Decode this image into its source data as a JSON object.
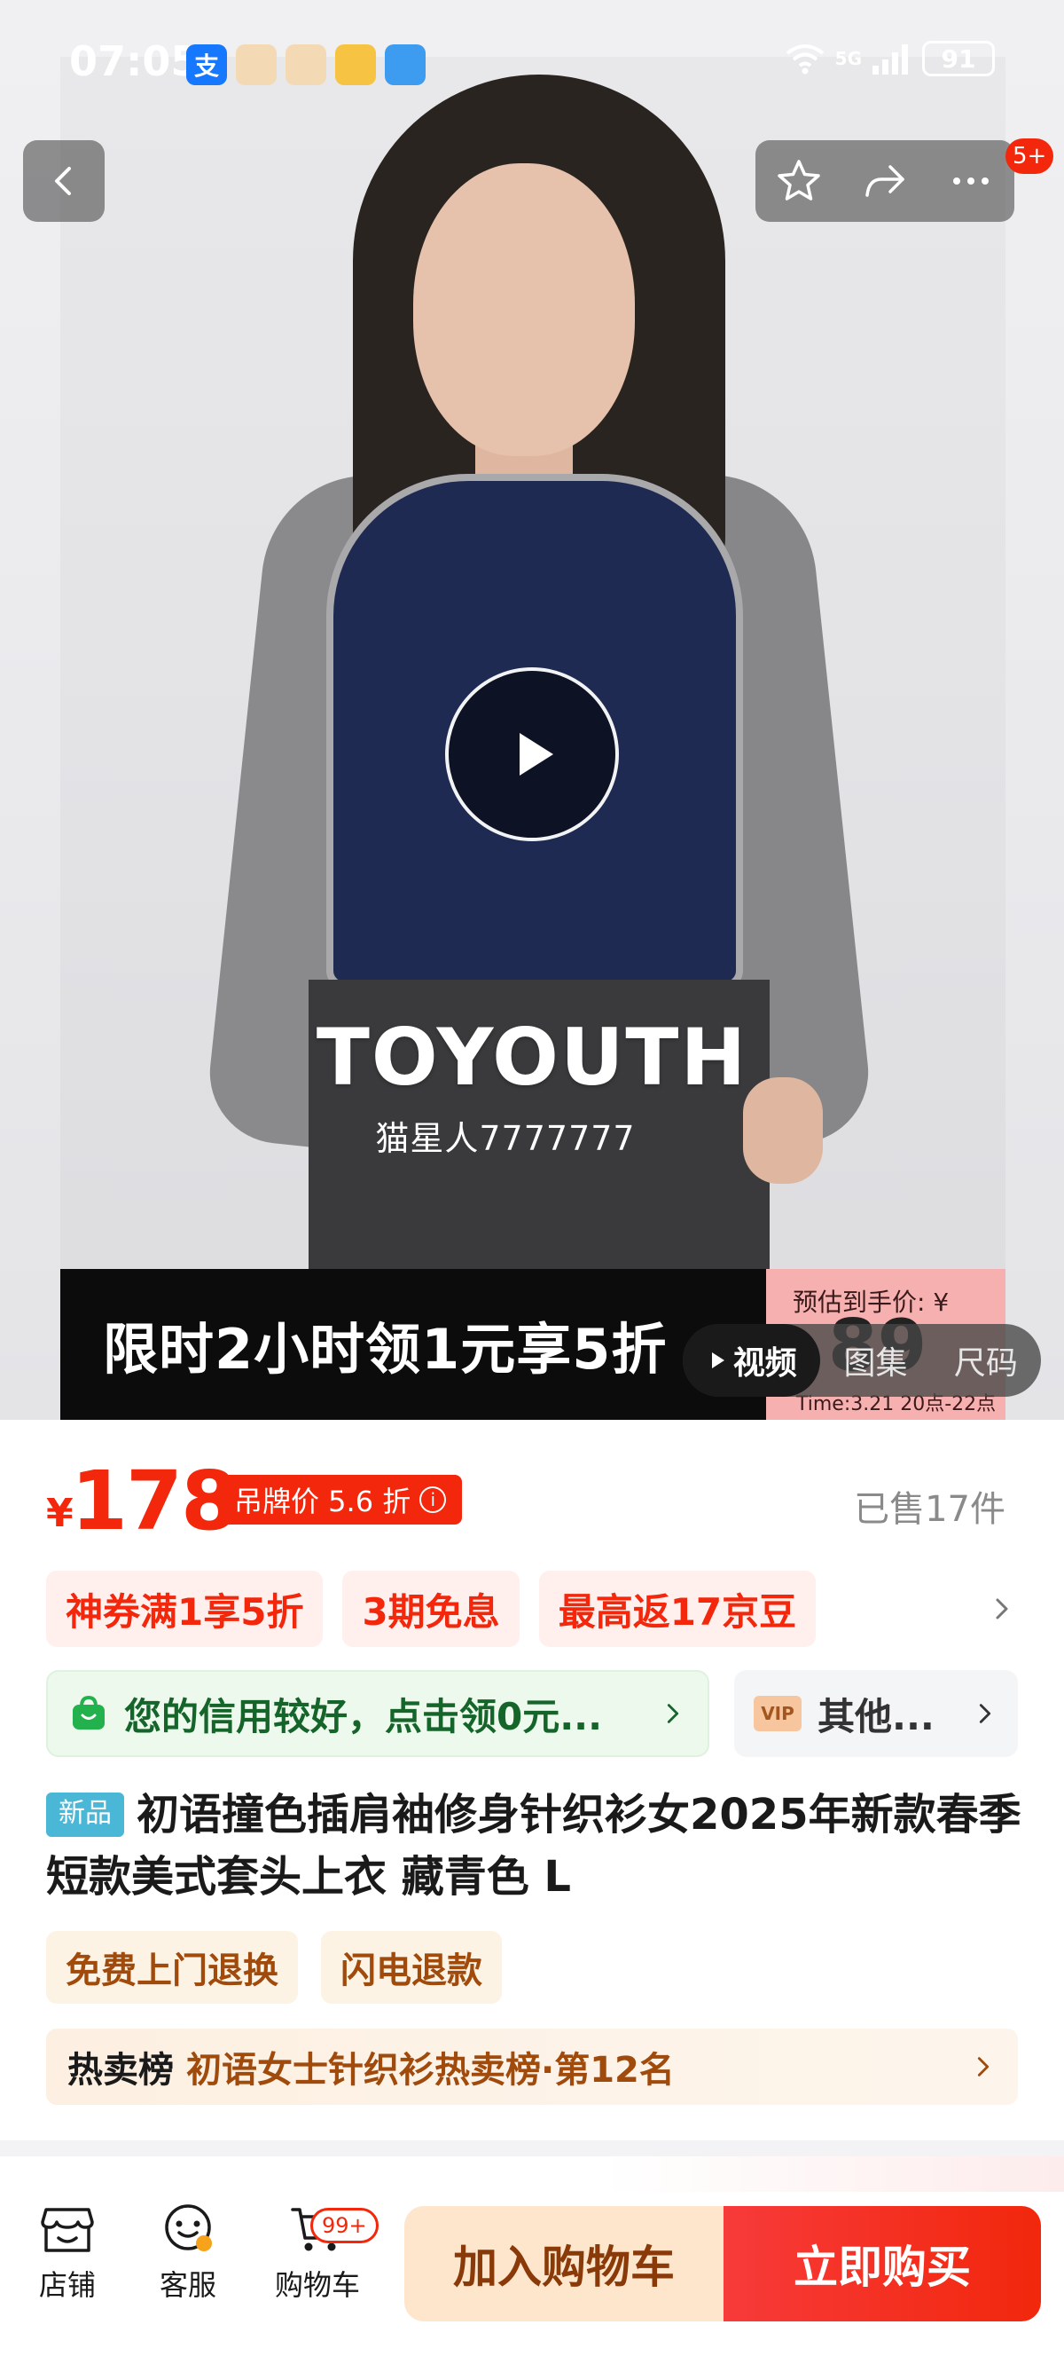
{
  "status_bar": {
    "time": "07:05",
    "network": "5G",
    "battery": "91"
  },
  "hero": {
    "watermark_brand": "TOYOUTH",
    "watermark_user": "猫星人7777777",
    "promo_text": "限时2小时领1元享5折",
    "price_card": {
      "label": "预估到手价: ¥",
      "value": "89",
      "time": "Time:3.21 20点-22点"
    },
    "media_tabs": [
      "视频",
      "图集",
      "尺码"
    ],
    "cart_badge": "5+"
  },
  "price": {
    "currency": "¥",
    "value": "178",
    "tag_price_label": "吊牌价 5.6 折",
    "sold": "已售17件"
  },
  "promotions": [
    "神券满1享5折",
    "3期免息",
    "最高返17京豆"
  ],
  "credit": {
    "text": "您的信用较好，点击领0元...",
    "vip_text": "其他...",
    "vip_icon_text": "VIP"
  },
  "product": {
    "new_tag": "新品",
    "title": "初语撞色插肩袖修身针织衫女2025年新款春季短款美式套头上衣 藏青色 L"
  },
  "services": [
    "免费上门退换",
    "闪电退款"
  ],
  "rank": {
    "label": "热卖榜",
    "text": "初语女士针织衫热卖榜·第12名"
  },
  "bottom_bar": {
    "shop_label": "店铺",
    "service_label": "客服",
    "cart_label": "购物车",
    "cart_badge": "99+",
    "add_to_cart": "加入购物车",
    "buy_now": "立即购买"
  },
  "colors": {
    "accent_red": "#f2270c",
    "credit_green": "#15652b",
    "service_brown": "#a04a0c"
  }
}
